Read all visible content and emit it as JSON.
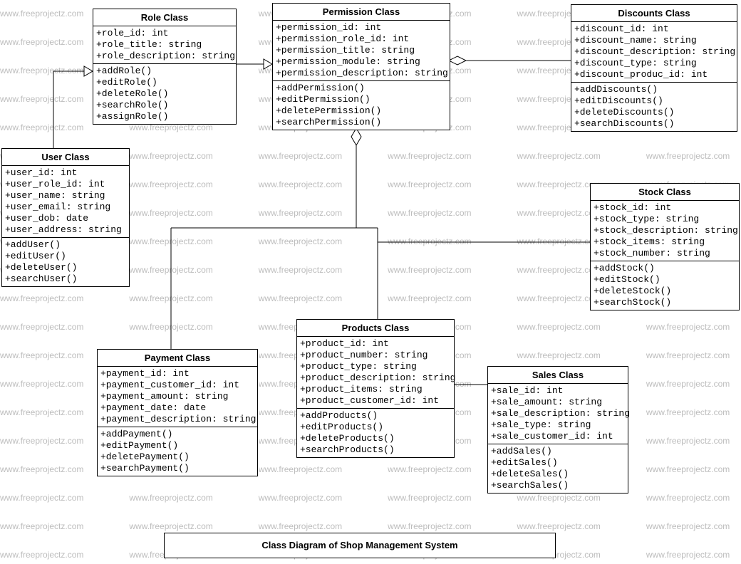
{
  "title": "Class Diagram of Shop Management System",
  "watermark": "www.freeprojectz.com",
  "classes": {
    "role": {
      "name": "Role Class",
      "attrs": [
        "+role_id: int",
        "+role_title: string",
        "+role_description: string"
      ],
      "ops": [
        "+addRole()",
        "+editRole()",
        "+deleteRole()",
        "+searchRole()",
        "+assignRole()"
      ]
    },
    "permission": {
      "name": "Permission Class",
      "attrs": [
        "+permission_id: int",
        "+permission_role_id: int",
        "+permission_title: string",
        "+permission_module: string",
        "+permission_description: string"
      ],
      "ops": [
        "+addPermission()",
        "+editPermission()",
        "+deletePermission()",
        "+searchPermission()"
      ]
    },
    "discounts": {
      "name": "Discounts Class",
      "attrs": [
        "+discount_id: int",
        "+discount_name: string",
        "+discount_description: string",
        "+discount_type: string",
        "+discount_produc_id: int"
      ],
      "ops": [
        "+addDiscounts()",
        "+editDiscounts()",
        "+deleteDiscounts()",
        "+searchDiscounts()"
      ]
    },
    "user": {
      "name": "User Class",
      "attrs": [
        "+user_id: int",
        "+user_role_id: int",
        "+user_name: string",
        "+user_email: string",
        "+user_dob: date",
        "+user_address: string"
      ],
      "ops": [
        "+addUser()",
        "+editUser()",
        "+deleteUser()",
        "+searchUser()"
      ]
    },
    "stock": {
      "name": "Stock Class",
      "attrs": [
        "+stock_id: int",
        "+stock_type: string",
        "+stock_description: string",
        "+stock_items: string",
        "+stock_number: string"
      ],
      "ops": [
        "+addStock()",
        "+editStock()",
        "+deleteStock()",
        "+searchStock()"
      ]
    },
    "products": {
      "name": "Products  Class",
      "attrs": [
        "+product_id: int",
        "+product_number: string",
        "+product_type: string",
        "+product_description: string",
        "+product_items: string",
        "+product_customer_id: int"
      ],
      "ops": [
        "+addProducts()",
        "+editProducts()",
        "+deleteProducts()",
        "+searchProducts()"
      ]
    },
    "payment": {
      "name": "Payment Class",
      "attrs": [
        "+payment_id: int",
        "+payment_customer_id: int",
        "+payment_amount: string",
        "+payment_date: date",
        "+payment_description: string"
      ],
      "ops": [
        "+addPayment()",
        "+editPayment()",
        "+deletePayment()",
        "+searchPayment()"
      ]
    },
    "sales": {
      "name": "Sales Class",
      "attrs": [
        "+sale_id: int",
        "+sale_amount: string",
        "+sale_description: string",
        "+sale_type: string",
        "+sale_customer_id: int"
      ],
      "ops": [
        "+addSales()",
        "+editSales()",
        "+deleteSales()",
        "+searchSales()"
      ]
    }
  }
}
